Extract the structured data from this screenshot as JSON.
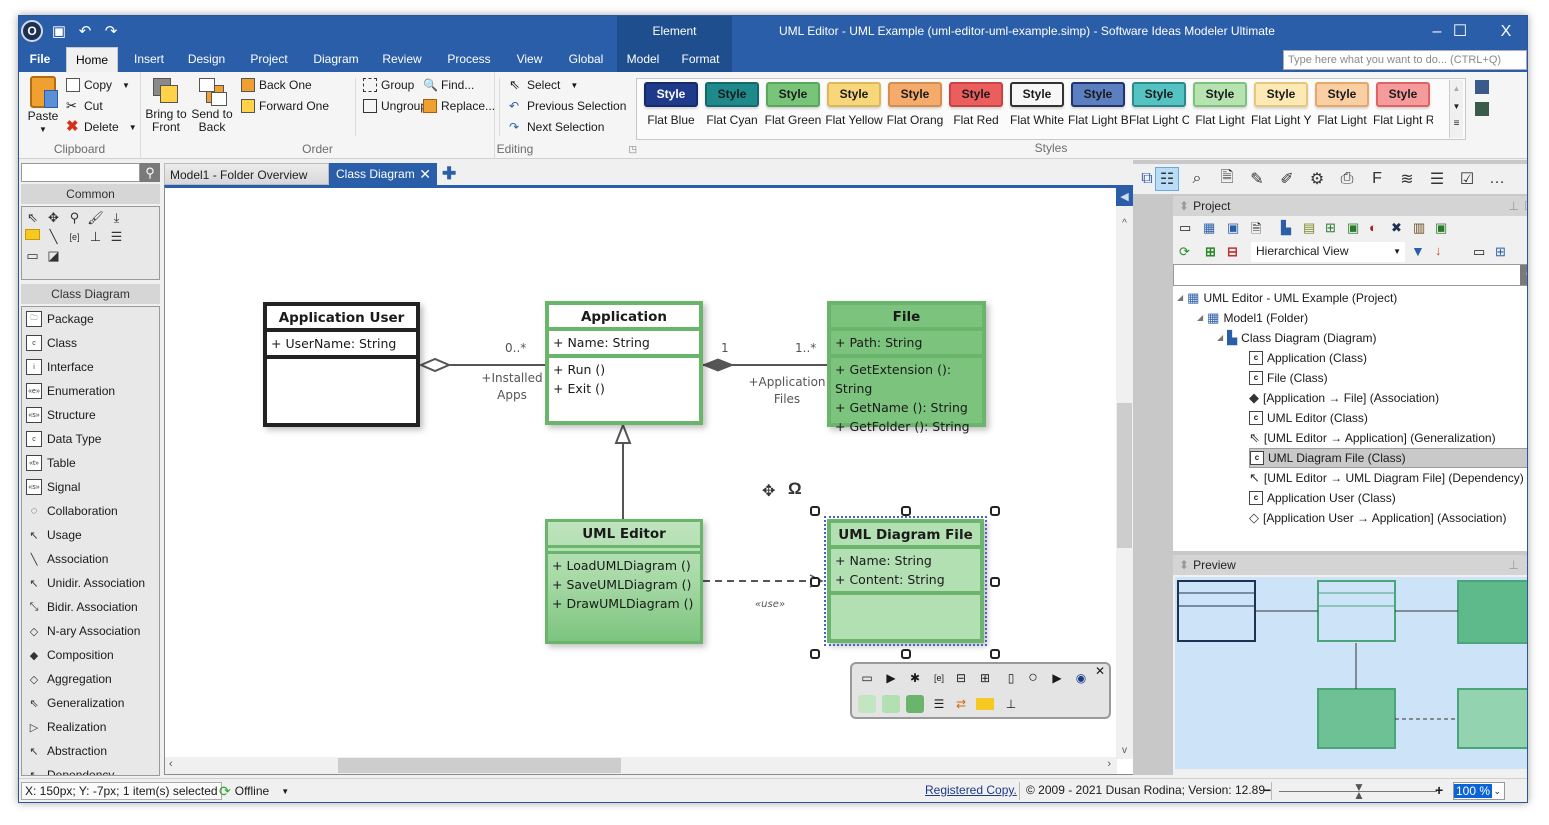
{
  "window": {
    "title": "UML Editor - UML Example (uml-editor-uml-example.simp) - Software Ideas Modeler Ultimate",
    "context_tab_header": "Element",
    "controls": {
      "minimize": "–",
      "maximize": "☐",
      "close": "X"
    }
  },
  "menu": {
    "tabs": [
      "File",
      "Home",
      "Insert",
      "Design",
      "Project",
      "Diagram",
      "Review",
      "Process",
      "View",
      "Global",
      "Model",
      "Format"
    ],
    "active": "Home",
    "search_placeholder": "Type here what you want to do... (CTRL+Q)"
  },
  "ribbon": {
    "clipboard": {
      "label": "Clipboard",
      "paste": "Paste",
      "copy": "Copy",
      "cut": "Cut",
      "delete": "Delete"
    },
    "order": {
      "label": "Order",
      "bring_to_front_1": "Bring to",
      "bring_to_front_2": "Front",
      "send_to_back_1": "Send to",
      "send_to_back_2": "Back",
      "back_one": "Back One",
      "forward_one": "Forward One",
      "group": "Group",
      "ungroup": "Ungroup"
    },
    "editing": {
      "label": "Editing",
      "find": "Find...",
      "replace": "Replace...",
      "select": "Select",
      "previous_selection": "Previous Selection",
      "next_selection": "Next Selection"
    },
    "styles": {
      "label": "Styles",
      "swatch_text": "Style",
      "items": [
        {
          "name": "Flat Blue",
          "bg": "#1f3a8a",
          "border": "#152b6a",
          "fg": "#ffffff"
        },
        {
          "name": "Flat Cyan",
          "bg": "#1e8a8c",
          "border": "#16696b",
          "fg": "#1a1a1a"
        },
        {
          "name": "Flat Green",
          "bg": "#78c57a",
          "border": "#5aa65c",
          "fg": "#1a1a1a"
        },
        {
          "name": "Flat Yellow",
          "bg": "#f7d77a",
          "border": "#dcb857",
          "fg": "#1a1a1a"
        },
        {
          "name": "Flat Orang",
          "bg": "#f5ab6c",
          "border": "#d68d50",
          "fg": "#1a1a1a"
        },
        {
          "name": "Flat Red",
          "bg": "#ec5d5d",
          "border": "#c94343",
          "fg": "#1a1a1a"
        },
        {
          "name": "Flat White",
          "bg": "#f7f7f7",
          "border": "#333333",
          "fg": "#1a1a1a"
        },
        {
          "name": "Flat Light B",
          "bg": "#5b7fc0",
          "border": "#22346e",
          "fg": "#1a1a1a"
        },
        {
          "name": "Flat Light C",
          "bg": "#56c3c3",
          "border": "#2c8a8c",
          "fg": "#1a1a1a"
        },
        {
          "name": "Flat Light",
          "bg": "#b6e3b0",
          "border": "#7dc17a",
          "fg": "#1a1a1a"
        },
        {
          "name": "Flat Light Y",
          "bg": "#fde9b5",
          "border": "#e8c77a",
          "fg": "#1a1a1a"
        },
        {
          "name": "Flat Light",
          "bg": "#fbcfa4",
          "border": "#e8a668",
          "fg": "#1a1a1a"
        },
        {
          "name": "Flat Light R",
          "bg": "#f59b9b",
          "border": "#e06262",
          "fg": "#1a1a1a"
        }
      ]
    }
  },
  "toolbox": {
    "search_value": "",
    "common_header": "Common",
    "class_diagram_header": "Class Diagram",
    "items": [
      {
        "label": "Package",
        "icon": "package-icon",
        "glyph": "🗀"
      },
      {
        "label": "Class",
        "icon": "class-icon",
        "glyph": "c"
      },
      {
        "label": "Interface",
        "icon": "interface-icon",
        "glyph": "i"
      },
      {
        "label": "Enumeration",
        "icon": "enumeration-icon",
        "glyph": "«e»"
      },
      {
        "label": "Structure",
        "icon": "structure-icon",
        "glyph": "«s»"
      },
      {
        "label": "Data Type",
        "icon": "datatype-icon",
        "glyph": "c"
      },
      {
        "label": "Table",
        "icon": "table-icon",
        "glyph": "«t»"
      },
      {
        "label": "Signal",
        "icon": "signal-icon",
        "glyph": "«s»"
      },
      {
        "label": "Collaboration",
        "icon": "collaboration-icon",
        "glyph": "◌"
      },
      {
        "label": "Usage",
        "icon": "usage-icon",
        "glyph": "↖"
      },
      {
        "label": "Association",
        "icon": "association-icon",
        "glyph": "╲"
      },
      {
        "label": "Unidir. Association",
        "icon": "unidir-association-icon",
        "glyph": "↖"
      },
      {
        "label": "Bidir. Association",
        "icon": "bidir-association-icon",
        "glyph": "⤡"
      },
      {
        "label": "N-ary Association",
        "icon": "nary-association-icon",
        "glyph": "◇"
      },
      {
        "label": "Composition",
        "icon": "composition-icon",
        "glyph": "◆"
      },
      {
        "label": "Aggregation",
        "icon": "aggregation-icon",
        "glyph": "◇"
      },
      {
        "label": "Generalization",
        "icon": "generalization-icon",
        "glyph": "⇖"
      },
      {
        "label": "Realization",
        "icon": "realization-icon",
        "glyph": "▷"
      },
      {
        "label": "Abstraction",
        "icon": "abstraction-icon",
        "glyph": "↖"
      },
      {
        "label": "Dependency",
        "icon": "dependency-icon",
        "glyph": "↖"
      }
    ]
  },
  "doc_tabs": [
    {
      "label": "Model1 - Folder Overview",
      "active": false
    },
    {
      "label": "Class Diagram",
      "active": true
    }
  ],
  "diagram": {
    "classes": [
      {
        "id": "application-user",
        "name": "Application User",
        "attributes": [
          "+ UserName: String"
        ],
        "operations": [],
        "style": "white"
      },
      {
        "id": "application",
        "name": "Application",
        "attributes": [
          "+ Name: String"
        ],
        "operations": [
          "+ Run ()",
          "+ Exit ()"
        ],
        "style": "outline-green"
      },
      {
        "id": "file",
        "name": "File",
        "attributes": [
          "+ Path: String"
        ],
        "operations": [
          "+ GetExtension (): String",
          "+ GetName (): String",
          "+ GetFolder (): String"
        ],
        "style": "green"
      },
      {
        "id": "uml-editor",
        "name": "UML Editor",
        "attributes": [],
        "operations": [
          "+ LoadUMLDiagram ()",
          "+ SaveUMLDiagram ()",
          "+ DrawUMLDiagram ()"
        ],
        "style": "light-green"
      },
      {
        "id": "uml-diagram-file",
        "name": "UML Diagram File",
        "attributes": [
          "+ Name: String",
          "+ Content: String"
        ],
        "operations": [],
        "style": "light-green",
        "selected": true
      }
    ],
    "labels": {
      "installed_mult": "0..*",
      "installed_role_1": "+Installed",
      "installed_role_2": "Apps",
      "app_file_mult_src": "1",
      "app_file_mult_dst": "1..*",
      "app_files_role_1": "+Application",
      "app_files_role_2": "Files",
      "use_stereotype": "«use»"
    }
  },
  "project_panel": {
    "title": "Project",
    "view_select": "Hierarchical View",
    "filter_value": "",
    "tree": [
      {
        "label": "UML Editor - UML Example (Project)",
        "level": 0,
        "icon": "project-icon",
        "expanded": true
      },
      {
        "label": "Model1 (Folder)",
        "level": 1,
        "icon": "folder-icon",
        "expanded": true
      },
      {
        "label": "Class Diagram (Diagram)",
        "level": 2,
        "icon": "diagram-icon",
        "expanded": true
      },
      {
        "label": "Application (Class)",
        "level": 3,
        "icon": "class-icon"
      },
      {
        "label": "File (Class)",
        "level": 3,
        "icon": "class-icon"
      },
      {
        "label": "[Application → File] (Association)",
        "level": 3,
        "icon": "composition-icon"
      },
      {
        "label": "UML Editor (Class)",
        "level": 3,
        "icon": "class-icon"
      },
      {
        "label": "[UML Editor → Application] (Generalization)",
        "level": 3,
        "icon": "generalization-icon"
      },
      {
        "label": "UML Diagram File (Class)",
        "level": 3,
        "icon": "class-icon",
        "selected": true
      },
      {
        "label": "[UML Editor → UML Diagram File] (Dependency)",
        "level": 3,
        "icon": "dependency-icon"
      },
      {
        "label": "Application User (Class)",
        "level": 3,
        "icon": "class-icon"
      },
      {
        "label": "[Application User → Application] (Association)",
        "level": 3,
        "icon": "aggregation-icon"
      }
    ]
  },
  "preview_panel": {
    "title": "Preview"
  },
  "status": {
    "position": "X: 150px; Y: -7px; 1 item(s) selected",
    "connection": "Offline",
    "registered": "Registered Copy.",
    "copyright": "© 2009 - 2021 Dusan Rodina; Version: 12.89",
    "zoom": "100 %",
    "zoom_slider_fraction": 0.5
  }
}
